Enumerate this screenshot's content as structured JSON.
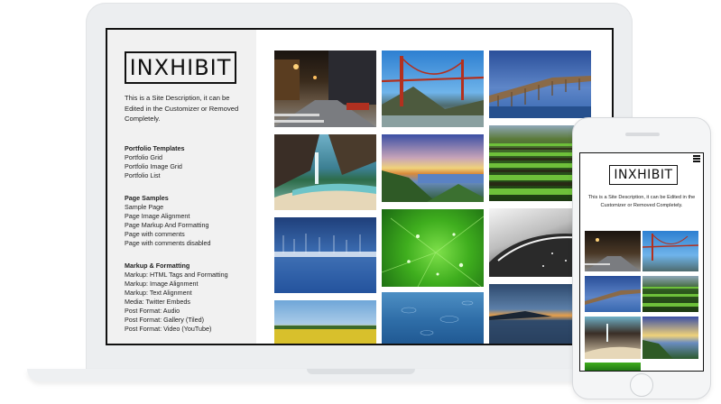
{
  "site": {
    "logo_text": "INXHIBIT",
    "description": "This is a Site Description, it can be Edited in the Customizer or Removed Completely."
  },
  "sidebar": {
    "groups": [
      {
        "title": "Portfolio Templates",
        "items": [
          "Portfolio Grid",
          "Portfolio Image Grid",
          "Portfolio List"
        ]
      },
      {
        "title": "Page Samples",
        "items": [
          "Sample Page",
          "Page Image Alignment",
          "Page Markup And Formatting",
          "Page with comments",
          "Page with comments disabled"
        ]
      },
      {
        "title": "Markup & Formatting",
        "items": [
          "Markup: HTML Tags and Formatting",
          "Markup: Image Alignment",
          "Markup: Text Alignment",
          "Media: Twitter Embeds",
          "Post Format: Audio",
          "Post Format: Gallery (Tiled)",
          "Post Format: Video (YouTube)"
        ]
      }
    ]
  },
  "portfolio": {
    "thumbnails": [
      {
        "name": "city-street-night"
      },
      {
        "name": "golden-gate-bridge"
      },
      {
        "name": "wooden-pier"
      },
      {
        "name": "coastal-waterfall"
      },
      {
        "name": "sunset-coast"
      },
      {
        "name": "crop-field-rows"
      },
      {
        "name": "harbor-blue"
      },
      {
        "name": "green-leaf-drops"
      },
      {
        "name": "bw-wave"
      },
      {
        "name": "yellow-meadow"
      },
      {
        "name": "rain-water"
      },
      {
        "name": "dusk-sea"
      }
    ]
  },
  "phone": {
    "logo_text": "INXHIBIT",
    "description": "This is a Site Description, it can be Edited in the Customizer or Removed Completely."
  },
  "colors": {
    "frame": "#111111",
    "sidebar_bg": "#f1f1f1",
    "device_shell": "#eceef0"
  }
}
